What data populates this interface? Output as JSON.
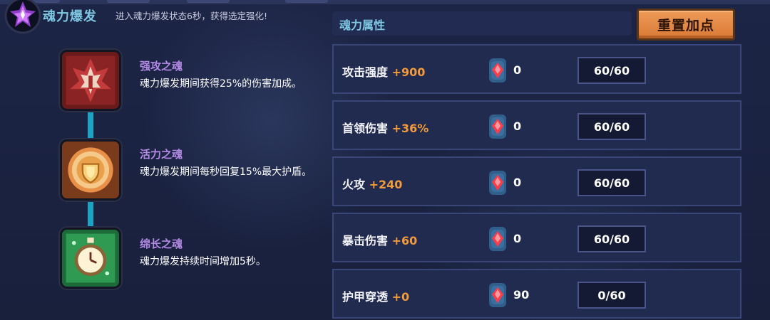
{
  "burst": {
    "title": "魂力爆发",
    "desc": "进入魂力爆发状态6秒，获得选定强化!"
  },
  "souls": [
    {
      "title": "强攻之魂",
      "desc": "魂力爆发期间获得25%的伤害加成。",
      "icon": "fire-flower-icon"
    },
    {
      "title": "活力之魂",
      "desc": "魂力爆发期间每秒回复15%最大护盾。",
      "icon": "shield-emblem-icon"
    },
    {
      "title": "绵长之魂",
      "desc": "魂力爆发持续时间增加5秒。",
      "icon": "stopwatch-icon"
    }
  ],
  "attributes": {
    "title": "魂力属性",
    "reset_label": "重置加点",
    "rows": [
      {
        "name": "攻击强度",
        "bonus": "+900",
        "gems": "0",
        "counter": "60/60"
      },
      {
        "name": "首领伤害",
        "bonus": "+36%",
        "gems": "0",
        "counter": "60/60"
      },
      {
        "name": "火攻",
        "bonus": "+240",
        "gems": "0",
        "counter": "60/60"
      },
      {
        "name": "暴击伤害",
        "bonus": "+60",
        "gems": "0",
        "counter": "60/60"
      },
      {
        "name": "护甲穿透",
        "bonus": "+0",
        "gems": "90",
        "counter": "0/60"
      }
    ]
  },
  "colors": {
    "accent_title": "#7ec8e3",
    "soul_title": "#b48ae6",
    "bonus": "#f39a3a",
    "reset_button": "#e8894a"
  }
}
